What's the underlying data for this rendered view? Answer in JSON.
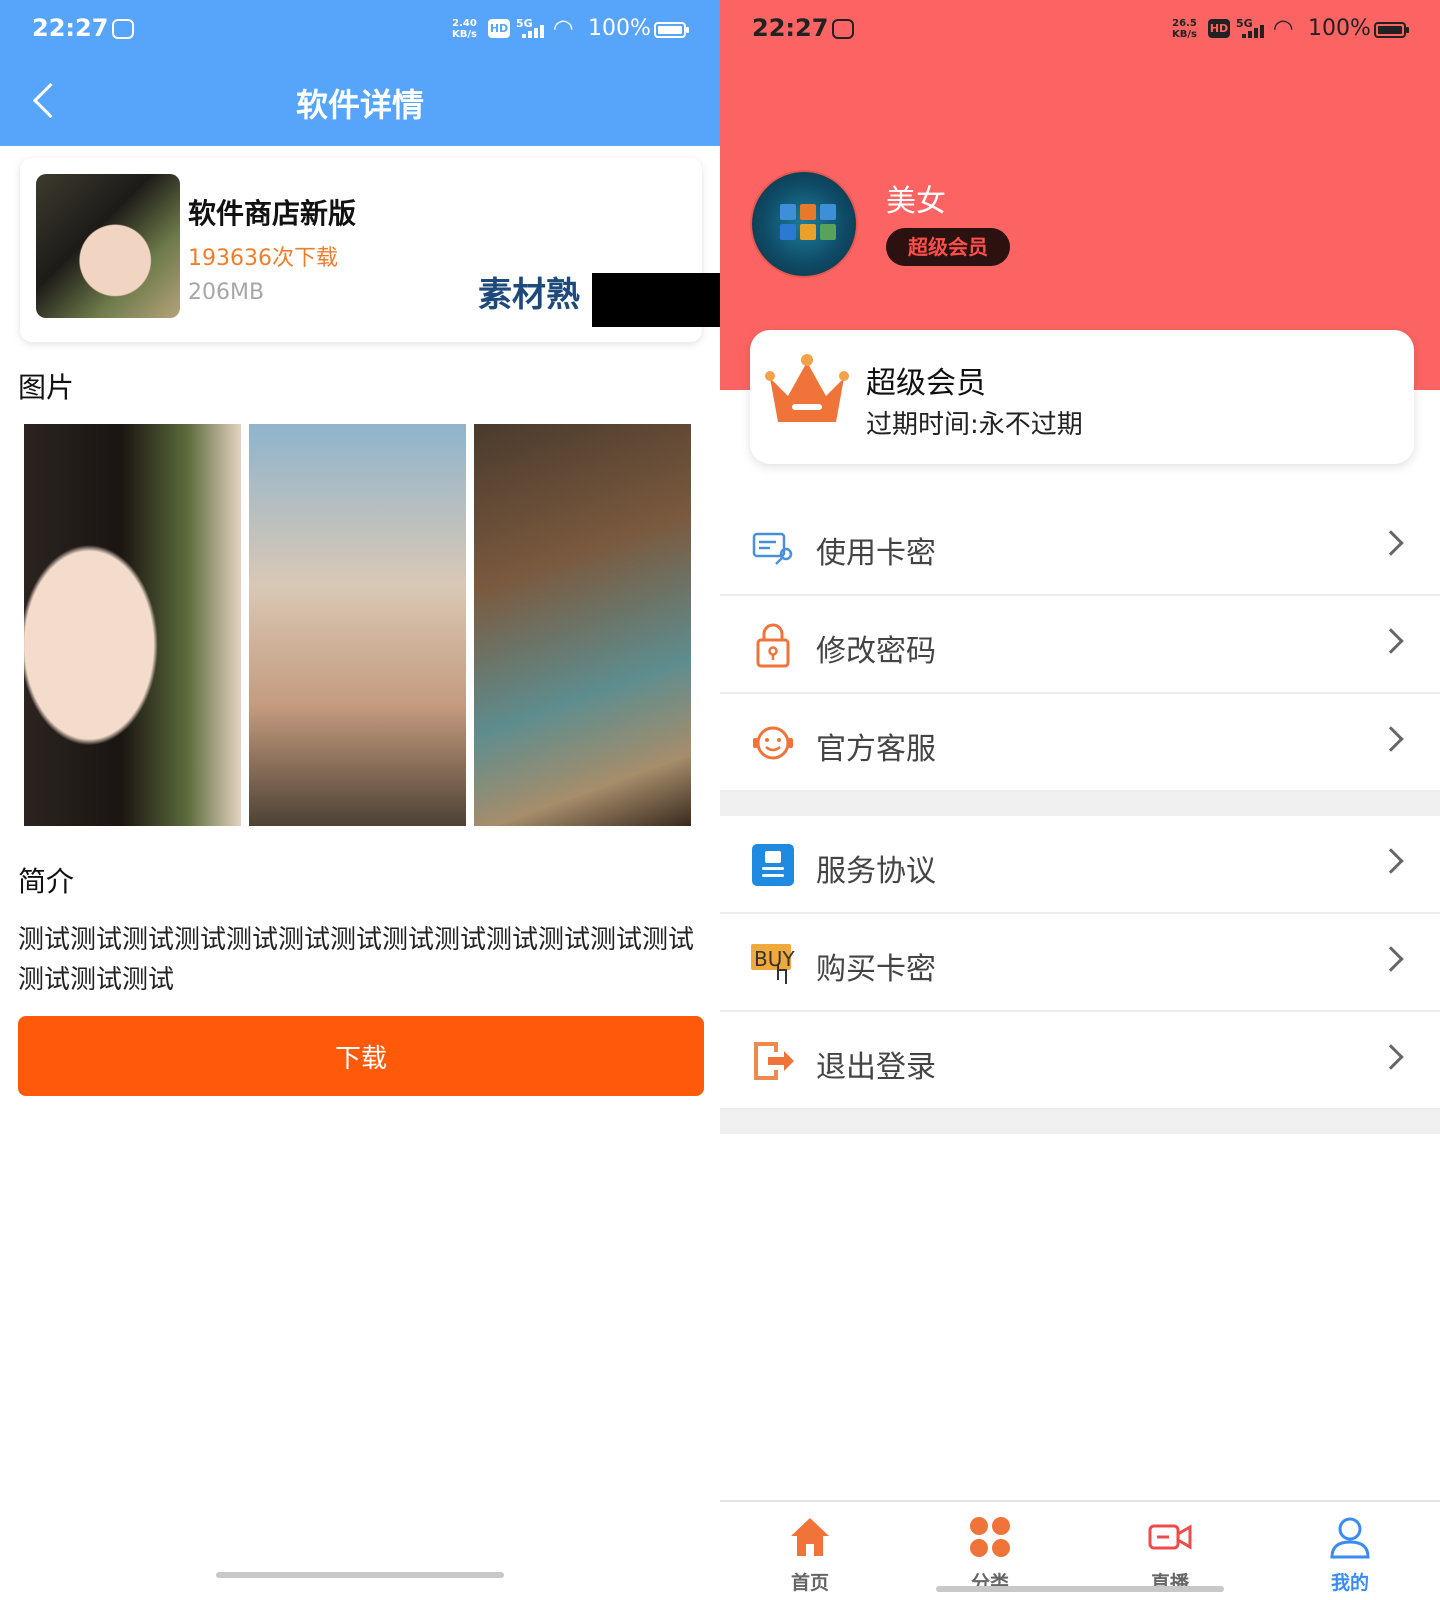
{
  "left": {
    "status_bar": {
      "time": "22:27",
      "net_speed_top": "2.40",
      "net_speed_unit": "KB/s",
      "hd": "HD",
      "signal": "5G",
      "battery": "100%"
    },
    "header": {
      "title": "软件详情"
    },
    "app": {
      "name": "软件商店新版",
      "downloads": "193636次下载",
      "size": "206MB"
    },
    "watermark": "素材熟",
    "images_section": {
      "title": "图片"
    },
    "intro_section": {
      "title": "简介",
      "text": "测试测试测试测试测试测试测试测试测试测试测试测试测试测试测试测试"
    },
    "download_button": "下载"
  },
  "right": {
    "status_bar": {
      "time": "22:27",
      "net_speed_top": "26.5",
      "net_speed_unit": "KB/s",
      "hd": "HD",
      "signal": "5G",
      "battery": "100%"
    },
    "profile": {
      "name": "美女",
      "badge": "超级会员"
    },
    "vip_card": {
      "title": "超级会员",
      "expiry": "过期时间:永不过期"
    },
    "menu_group_1": [
      {
        "label": "使用卡密",
        "icon": "card-key-icon"
      },
      {
        "label": "修改密码",
        "icon": "lock-icon"
      },
      {
        "label": "官方客服",
        "icon": "headset-icon"
      }
    ],
    "menu_group_2": [
      {
        "label": "服务协议",
        "icon": "document-icon"
      },
      {
        "label": "购买卡密",
        "icon": "buy-icon"
      },
      {
        "label": "退出登录",
        "icon": "logout-icon"
      }
    ],
    "tabs": [
      {
        "label": "首页",
        "icon": "home-icon"
      },
      {
        "label": "分类",
        "icon": "category-icon"
      },
      {
        "label": "直播",
        "icon": "live-icon"
      },
      {
        "label": "我的",
        "icon": "user-icon",
        "active": true
      }
    ],
    "colors": {
      "header": "#fb6462",
      "accent": "#ef7d2c",
      "tab_active": "#3b8cf0"
    }
  }
}
